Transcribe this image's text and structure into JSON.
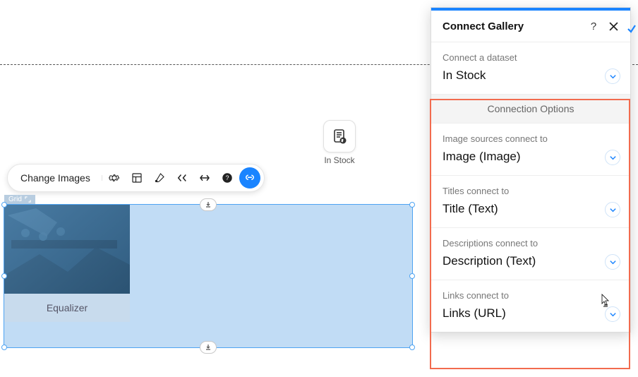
{
  "toolbar": {
    "change_images": "Change Images"
  },
  "dataset_widget": {
    "caption": "In Stock"
  },
  "selection": {
    "grid_tag": "Grid",
    "item_caption": "Equalizer"
  },
  "panel": {
    "title": "Connect Gallery",
    "dataset": {
      "label": "Connect a dataset",
      "value": "In Stock"
    },
    "section_heading": "Connection Options",
    "rows": [
      {
        "label": "Image sources connect to",
        "value": "Image (Image)"
      },
      {
        "label": "Titles connect to",
        "value": "Title (Text)"
      },
      {
        "label": "Descriptions connect to",
        "value": "Description (Text)"
      },
      {
        "label": "Links connect to",
        "value": "Links (URL)"
      }
    ]
  }
}
